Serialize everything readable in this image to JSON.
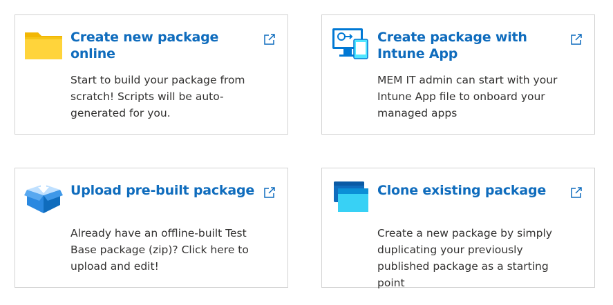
{
  "cards": [
    {
      "title": "Create new package online",
      "description": "Start to build your package from scratch! Scripts will be auto-generated for you.",
      "icon": "folder-icon",
      "link_icon": "open-external-icon"
    },
    {
      "title": "Create package with Intune App",
      "description": "MEM IT admin can start with your Intune App file to onboard your managed apps",
      "icon": "devices-transfer-icon",
      "link_icon": "open-external-icon"
    },
    {
      "title": "Upload pre-built package",
      "description": "Already have an offline-built Test Base package (zip)? Click here to upload and edit!",
      "icon": "box-upload-icon",
      "link_icon": "open-external-icon"
    },
    {
      "title": "Clone existing package",
      "description": "Create a new package by simply duplicating your previously published package as a starting point",
      "icon": "clone-windows-icon",
      "link_icon": "open-external-icon"
    }
  ],
  "colors": {
    "title": "#0f6cbd",
    "text": "#323130",
    "border": "#d1d1d1"
  }
}
